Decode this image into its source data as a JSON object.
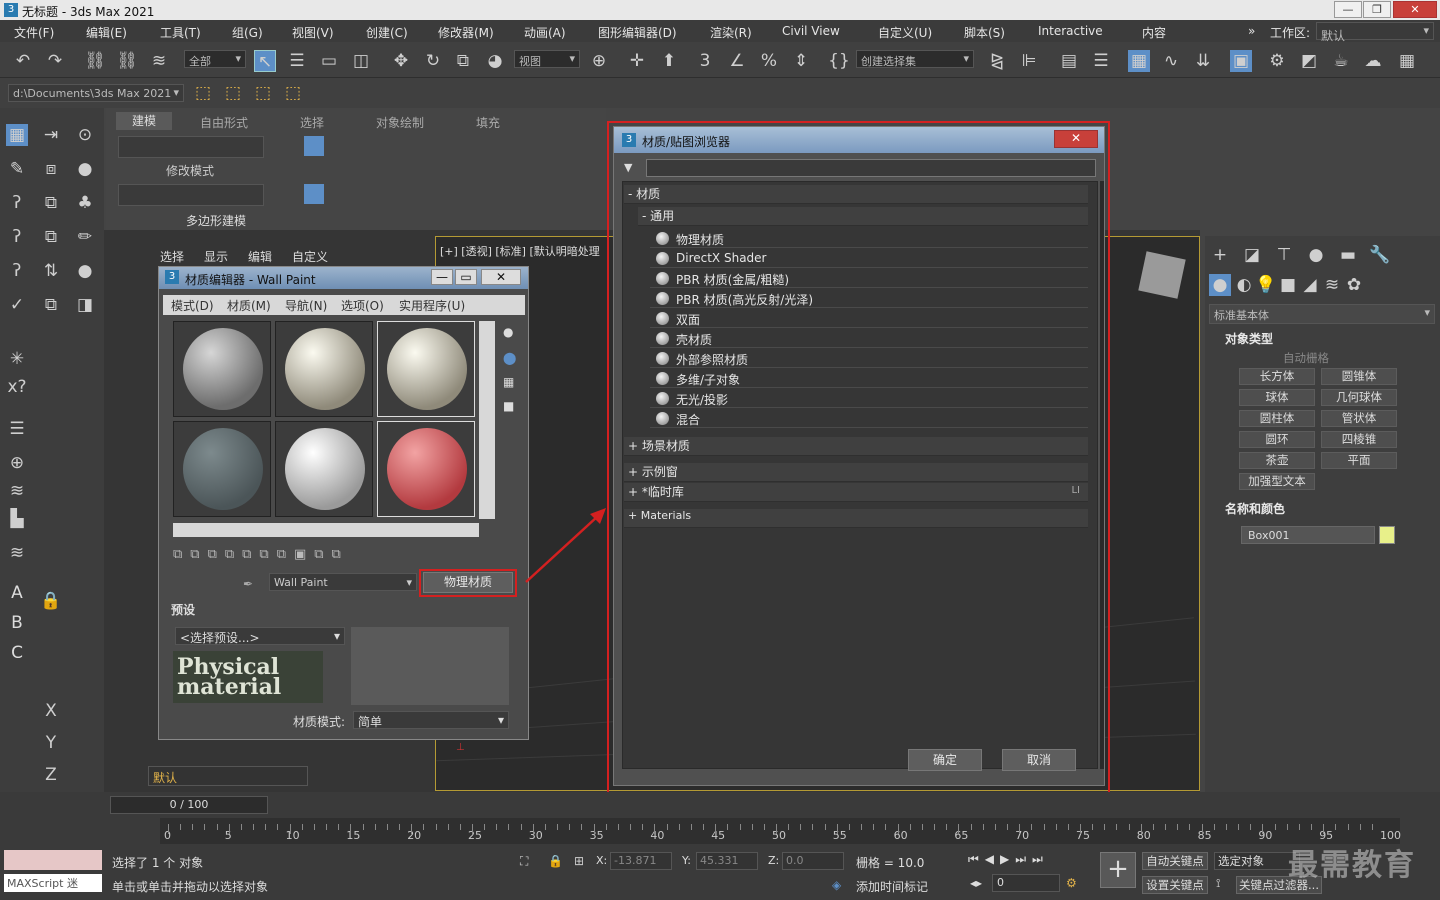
{
  "window": {
    "title": "无标题 - 3ds Max 2021",
    "min": "—",
    "max": "❐",
    "close": "✕"
  },
  "menu": [
    "文件(F)",
    "编辑(E)",
    "工具(T)",
    "组(G)",
    "视图(V)",
    "创建(C)",
    "修改器(M)",
    "动画(A)",
    "图形编辑器(D)",
    "渲染(R)",
    "Civil View",
    "自定义(U)",
    "脚本(S)",
    "Interactive",
    "内容"
  ],
  "workspace": {
    "label": "工作区:",
    "value": "默认"
  },
  "toolbar": {
    "filter": "全部",
    "view": "视图",
    "selset": "创建选择集"
  },
  "path": "d:\\Documents\\3ds Max 2021",
  "ribbon": {
    "tabs": [
      "建模",
      "自由形式",
      "选择",
      "对象绘制",
      "填充"
    ],
    "mode": "修改模式",
    "group": "多边形建模"
  },
  "scene_tabs": [
    "选择",
    "显示",
    "编辑",
    "自定义"
  ],
  "viewport_label": "[+] [透视] [标准] [默认明暗处理",
  "mat_editor": {
    "title": "材质编辑器 - Wall Paint",
    "menu": [
      "模式(D)",
      "材质(M)",
      "导航(N)",
      "选项(O)",
      "实用程序(U)"
    ],
    "mat_name": "Wall Paint",
    "mat_type": "物理材质",
    "preset_section": "预设",
    "preset_select": "<选择预设...>",
    "mode_label": "材质模式:",
    "mode_value": "简单",
    "logo_text": "Physical material"
  },
  "browser": {
    "title": "材质/贴图浏览器",
    "search_placeholder": "",
    "cat_materials": "- 材质",
    "cat_general": "- 通用",
    "general_items": [
      "物理材质",
      "DirectX Shader",
      "PBR 材质(金属/粗糙)",
      "PBR 材质(高光反射/光泽)",
      "双面",
      "壳材质",
      "外部参照材质",
      "多维/子对象",
      "无光/投影",
      "混合"
    ],
    "cat_scene": "+ 场景材质",
    "cat_sample": "+ 示例窗",
    "cat_temp": "+ *临时库",
    "cat_temp_right": "LI",
    "cat_materials2": "+ Materials",
    "ok": "确定",
    "cancel": "取消"
  },
  "cmdpanel": {
    "category": "标准基本体",
    "sec_objtype": "对象类型",
    "autogrid": "自动栅格",
    "buttons": [
      "长方体",
      "圆锥体",
      "球体",
      "几何球体",
      "圆柱体",
      "管状体",
      "圆环",
      "四棱锥",
      "茶壶",
      "平面"
    ],
    "extra": "加强型文本",
    "sec_name": "名称和颜色",
    "name": "Box001",
    "color": "#e8f08a"
  },
  "bottom": {
    "layer": "默认",
    "frame": "0 / 100",
    "status1": "选择了 1 个 对象",
    "status2": "单击或单击并拖动以选择对象",
    "script": "MAXScript 迷",
    "x_label": "X:",
    "x": "-13.871",
    "y_label": "Y:",
    "y": "45.331",
    "z_label": "Z:",
    "z": "0.0",
    "grid": "栅格 = 10.0",
    "addtime": "添加时间标记",
    "autokey": "自动关键点",
    "selobj": "选定对象",
    "setkey": "设置关键点",
    "keyfilter": "关键点过滤器...",
    "frame_field": "0",
    "watermark": "最需教育"
  },
  "timeline_labels": [
    "0",
    "5",
    "10",
    "15",
    "20",
    "25",
    "30",
    "35",
    "40",
    "45",
    "50",
    "55",
    "60",
    "65",
    "70",
    "75",
    "80",
    "85",
    "90",
    "95",
    "100"
  ]
}
